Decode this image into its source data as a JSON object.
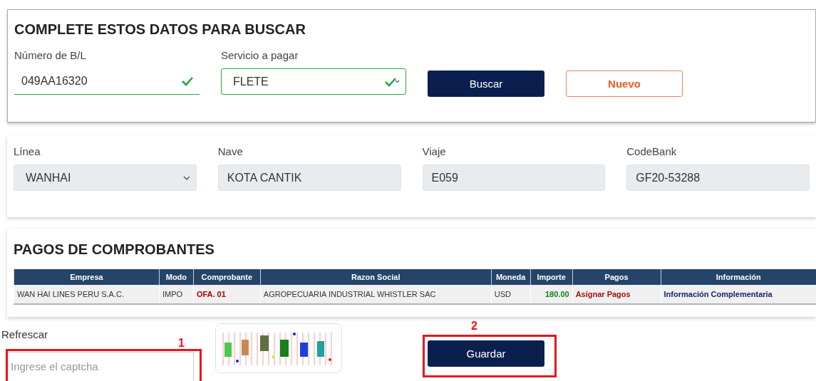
{
  "search_card": {
    "title": "COMPLETE ESTOS DATOS PARA BUSCAR",
    "fields": [
      {
        "kind": "input",
        "label": "Número de B/L",
        "value": "049AA16320",
        "valid": true
      },
      {
        "kind": "select",
        "label": "Servicio a pagar",
        "value": "FLETE",
        "valid": true
      }
    ],
    "buttons": [
      {
        "kind": "primary",
        "label": "Buscar"
      },
      {
        "kind": "outline",
        "label": "Nuevo"
      }
    ]
  },
  "details_card": {
    "fields": [
      {
        "kind": "select",
        "label": "Línea",
        "value": "WANHAI"
      },
      {
        "kind": "readonly",
        "label": "Nave",
        "value": "KOTA CANTIK"
      },
      {
        "kind": "readonly",
        "label": "Viaje",
        "value": "E059"
      },
      {
        "kind": "readonly",
        "label": "CodeBank",
        "value": "GF20-53288"
      }
    ]
  },
  "payments_card": {
    "title": "PAGOS DE COMPROBANTES",
    "table": {
      "columns": [
        "Empresa",
        "Modo",
        "Comprobante",
        "Razon Social",
        "Moneda",
        "Importe",
        "Pagos",
        "Información"
      ],
      "rows": [
        [
          {
            "kind": "plain",
            "text": "WAN HAI LINES PERU S.A.C."
          },
          {
            "kind": "plain",
            "text": "IMPO"
          },
          {
            "kind": "code",
            "text": "OFA. 01"
          },
          {
            "kind": "plain",
            "text": "AGROPECUARIA INDUSTRIAL WHISTLER SAC"
          },
          {
            "kind": "plain",
            "text": "USD"
          },
          {
            "kind": "amount",
            "text": "180.00"
          },
          {
            "kind": "action",
            "text": "Asignar Pagos"
          },
          {
            "kind": "info",
            "text": "Información Complementaria"
          }
        ]
      ]
    }
  },
  "captcha": {
    "refresh_label": "Refrescar",
    "placeholder": "Ingrese el captcha",
    "annotation": "1"
  },
  "save_button": {
    "label": "Guardar",
    "annotation": "2"
  }
}
